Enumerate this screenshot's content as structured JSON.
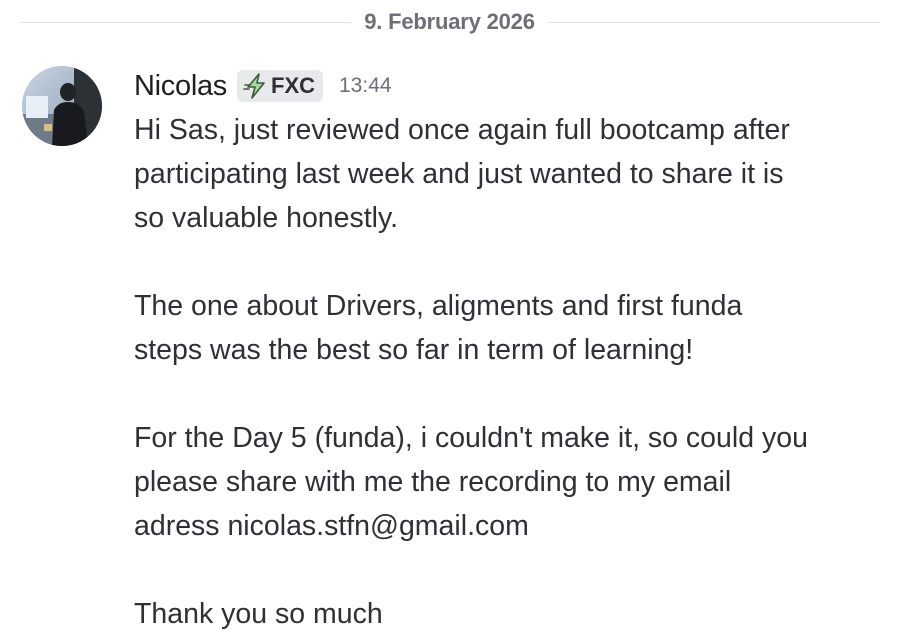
{
  "date_divider": {
    "label": "9. February 2026"
  },
  "message": {
    "author": "Nicolas",
    "badge": {
      "icon": "lightning-bolt-icon",
      "label": "FXC"
    },
    "timestamp": "13:44",
    "paragraphs": [
      "Hi Sas, just reviewed once again full bootcamp after\nparticipating last week and just wanted to share it is\nso valuable honestly.",
      "The one about Drivers, aligments and first funda\nsteps was the best so far in term of learning!",
      "For the Day 5 (funda), i couldn't make it, so could you\nplease share with me the recording to my email\nadress nicolas.stfn@gmail.com",
      "Thank you so much"
    ]
  },
  "colors": {
    "background": "#ffffff",
    "text": "#2e3035",
    "muted": "#6d6f78",
    "badge_bg": "#e8e9eb",
    "bolt_fill": "#a8d8a0"
  }
}
